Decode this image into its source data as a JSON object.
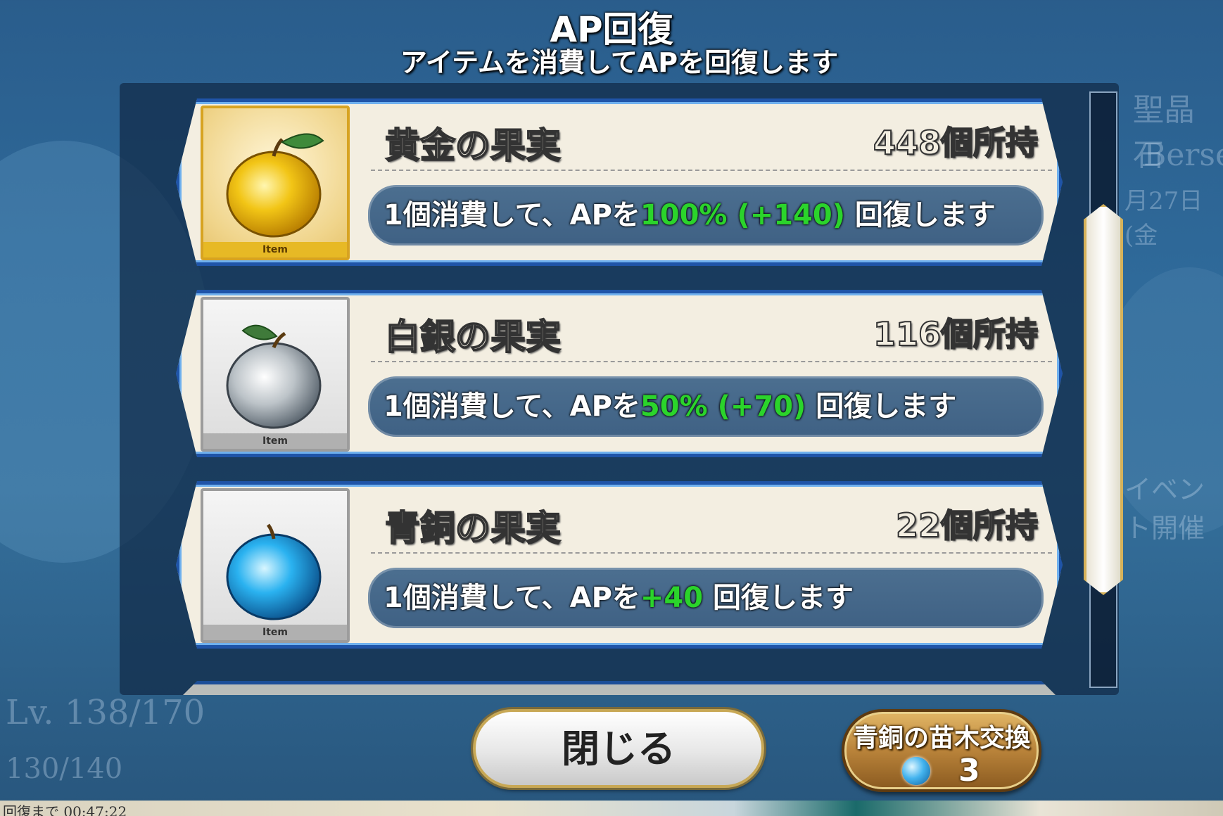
{
  "header": {
    "title": "AP回復",
    "subtitle": "アイテムを消費してAPを回復します"
  },
  "items": [
    {
      "name": "黄金の果実",
      "count": "448個所持",
      "tag": "Item",
      "effect_prefix": "1個消費して、APを",
      "effect_value": "100% (+140)",
      "effect_suffix": " 回復します",
      "icon": "golden-apple-icon",
      "color": "#e7b925"
    },
    {
      "name": "白銀の果実",
      "count": "116個所持",
      "tag": "Item",
      "effect_prefix": "1個消費して、APを",
      "effect_value": "50% (+70)",
      "effect_suffix": " 回復します",
      "icon": "silver-apple-icon",
      "color": "#c9c9c9"
    },
    {
      "name": "青銅の果実",
      "count": "22個所持",
      "tag": "Item",
      "effect_prefix": "1個消費して、APを",
      "effect_value": "+40",
      "effect_suffix": " 回復します",
      "icon": "bronze-apple-icon",
      "color": "#2aa6e6"
    }
  ],
  "buttons": {
    "close": "閉じる",
    "exchange_label": "青銅の苗木交換",
    "exchange_cost": "3",
    "exchange_icon": "bronze-sapling-gem-icon"
  },
  "background": {
    "level_text": "Lv. 138/170",
    "ap_text": "130/140",
    "recovery_timer": "回復まで 00:47:22",
    "date_text": "月27日(金",
    "event_text": "イベント開催",
    "ce_text": "聖晶石",
    "class_text": "Berse"
  },
  "colors": {
    "effect_highlight": "#2bd42b",
    "card_border": "#1f54a8",
    "panel_bg": "#102a46"
  }
}
